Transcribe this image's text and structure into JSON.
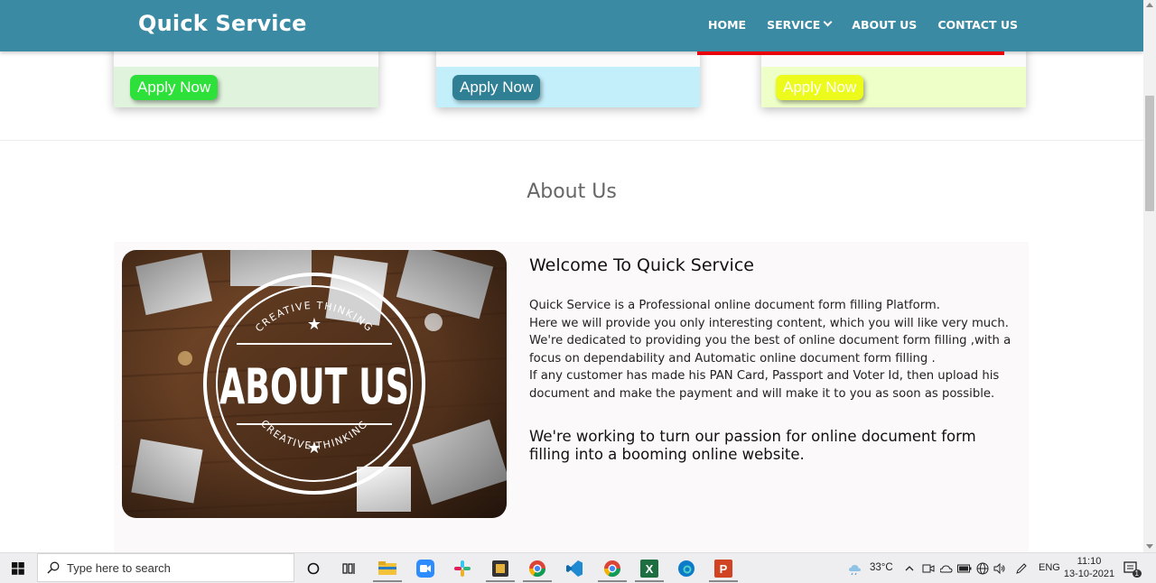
{
  "header": {
    "brand": "Quick Service",
    "nav": [
      {
        "label": "HOME"
      },
      {
        "label": "SERVICE"
      },
      {
        "label": "ABOUT US"
      },
      {
        "label": "CONTACT US"
      }
    ]
  },
  "cards": [
    {
      "button": "Apply Now"
    },
    {
      "button": "Apply Now"
    },
    {
      "button": "Apply Now"
    }
  ],
  "about": {
    "section_title": "About Us",
    "image_text": {
      "main": "ABOUT US",
      "ring_top": "CREATIVE THINKING",
      "ring_bottom": "CREATIVE THINKING"
    },
    "heading": "Welcome To Quick Service",
    "lines": [
      "Quick Service is a Professional online document form filling Platform.",
      "Here we will provide you only interesting content, which you will like very much.",
      "We're dedicated to providing you the best of online document form filling ,with a focus on dependability and Automatic online document form filling .",
      "If any customer has made his PAN Card, Passport and Voter Id, then upload his document and make the payment and will make it to you as soon as possible."
    ],
    "tagline": "We're working to turn our passion for online document form filling into a booming online website."
  },
  "taskbar": {
    "search_placeholder": "Type here to search",
    "weather": "33°C",
    "language": "ENG",
    "time": "11:10",
    "date": "13-10-2021",
    "notification_count": "1",
    "icons": [
      "windows-start-icon",
      "search-icon",
      "cortana-icon",
      "task-view-icon",
      "file-explorer-icon",
      "zoom-icon",
      "slack-icon",
      "app-icon",
      "chrome-profile-icon",
      "vscode-icon",
      "chrome-icon",
      "excel-icon",
      "edge-icon",
      "powerpoint-icon"
    ]
  }
}
